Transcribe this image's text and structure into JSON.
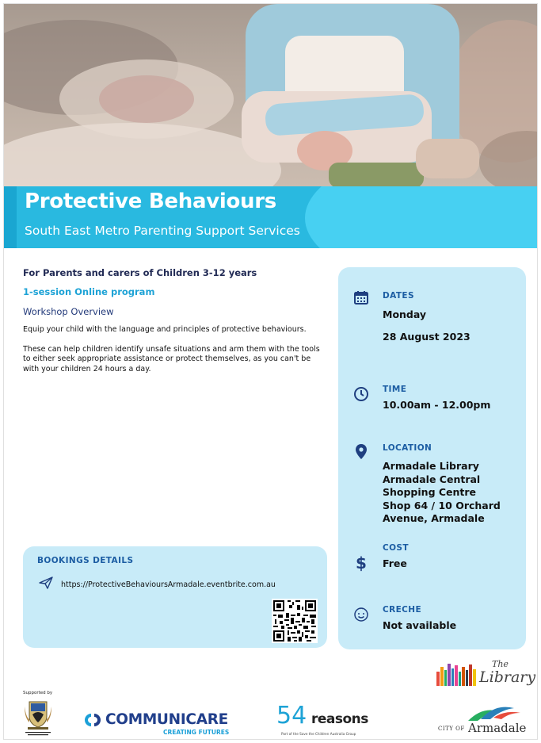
{
  "banner": {
    "title": "Protective Behaviours",
    "subtitle": "South East Metro Parenting Support Services"
  },
  "intro": {
    "audience": "For Parents and carers of Children 3-12 years",
    "program": "1-session Online program",
    "overview_heading": "Workshop Overview",
    "paragraph1": "Equip your child with the language and principles of protective behaviours.",
    "paragraph2": "These can help children identify unsafe situations and arm them with the tools to either seek appropriate assistance or protect themselves, as you can't be with your children 24 hours a day."
  },
  "details": {
    "dates_label": "DATES",
    "dates_day": "Monday",
    "dates_date": "28 August 2023",
    "time_label": "TIME",
    "time_value": "10.00am - 12.00pm",
    "location_label": "LOCATION",
    "location_lines": [
      "Armadale Library",
      "Armadale Central",
      "Shopping Centre",
      "Shop 64 / 10 Orchard",
      "Avenue, Armadale"
    ],
    "cost_label": "COST",
    "cost_value": "Free",
    "creche_label": "CRECHE",
    "creche_value": "Not available"
  },
  "bookings": {
    "title": "BOOKINGS DETAILS",
    "link": "https://ProtectiveBehavioursArmadale.eventbrite.com.au"
  },
  "footer": {
    "supported_by": "Supported by",
    "crest_text": "GOVERNMENT OF WESTERN AUSTRALIA",
    "communicare_name": "COMMUNICARE",
    "communicare_tagline": "CREATING FUTURES",
    "reasons_number": "54",
    "reasons_word": "reasons",
    "reasons_tagline": "Part of the Save the Children Australia Group",
    "library_the": "The",
    "library_word": "Library",
    "armadale_city": "CITY OF",
    "armadale_name": "Armadale"
  },
  "colors": {
    "banner": "#29b9e0",
    "panel": "#c8ebf8",
    "heading_navy": "#222b55",
    "accent_blue": "#1ea3d6",
    "label_blue": "#1c5da3"
  },
  "icons": [
    "calendar-icon",
    "clock-icon",
    "location-pin-icon",
    "dollar-icon",
    "smiley-icon",
    "send-icon",
    "qr-code"
  ]
}
